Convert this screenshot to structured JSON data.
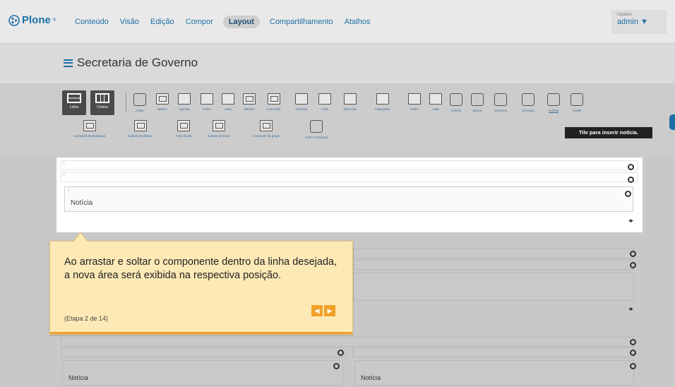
{
  "toolbar": {
    "brand": "Plone",
    "brand_mark": "®",
    "menu": [
      "Conteúdo",
      "Visão",
      "Edição",
      "Compor",
      "Layout",
      "Compartilhamento",
      "Atalhos"
    ],
    "active_menu": "Layout",
    "user_label": "Usuário",
    "user_name": "admin ▼"
  },
  "page": {
    "title": "Secretaria de Governo"
  },
  "palette": {
    "layout_buttons": [
      "Linha",
      "Coluna"
    ],
    "tiles_row1": [
      "Artigo",
      "Básico",
      "Agenda",
      "Áudio",
      "Lista",
      "Banner",
      "Carrossel",
      "Coleção",
      "Lista",
      "Texto-fixo",
      "Cabeçalho",
      "Vídeo",
      "Lista",
      "Canais",
      "Busca",
      "Números",
      "Serviços",
      "Notícia",
      "Cards"
    ],
    "tiles_row2": [
      "Carrossel de destaque",
      "Galeria de álbuns",
      "Foto do dia",
      "Galeria de fotos",
      "Carrossel de grupo",
      "Vídeo Carrossel"
    ],
    "tooltip": "Tile para inserir notícia."
  },
  "drop_area": {
    "card_title": "Notícia"
  },
  "lower_cards": {
    "left_title": "Notícia",
    "right_title": "Notícia"
  },
  "callout": {
    "text": "Ao arrastar e soltar o componente dentro da linha desejada, a nova área será exibida na respectiva posição.",
    "step": "(Etapa 2 de 14)",
    "prev": "◀",
    "next": "▶"
  },
  "colors": {
    "accent": "#1c6fa6",
    "callout_bg": "#fde9b6",
    "callout_button": "#f2a12b"
  }
}
